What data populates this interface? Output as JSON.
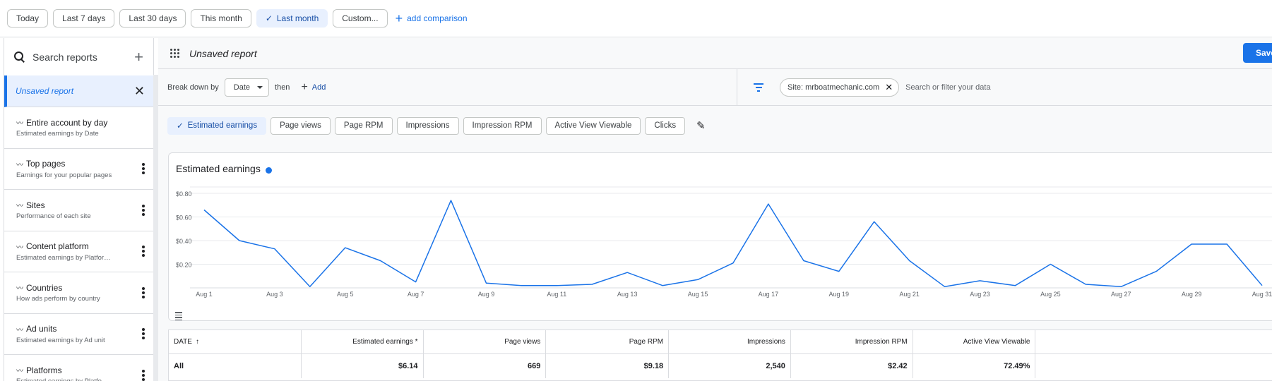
{
  "date_filters": {
    "chips": [
      "Today",
      "Last 7 days",
      "Last 30 days",
      "This month",
      "Last month",
      "Custom..."
    ],
    "selected": "Last month",
    "add_comparison": "add comparison"
  },
  "sidebar": {
    "search_placeholder": "Search reports",
    "active_report": "Unsaved report",
    "reports": [
      {
        "title": "Entire account by day",
        "subtitle": "Estimated earnings by Date",
        "has_menu": false
      },
      {
        "title": "Top pages",
        "subtitle": "Earnings for your popular pages",
        "has_menu": true
      },
      {
        "title": "Sites",
        "subtitle": "Performance of each site",
        "has_menu": true
      },
      {
        "title": "Content platform",
        "subtitle": "Estimated earnings by Platfor…",
        "has_menu": true
      },
      {
        "title": "Countries",
        "subtitle": "How ads perform by country",
        "has_menu": true
      },
      {
        "title": "Ad units",
        "subtitle": "Estimated earnings by Ad unit",
        "has_menu": true
      },
      {
        "title": "Platforms",
        "subtitle": "Estimated earnings by Platfo…",
        "has_menu": true
      }
    ]
  },
  "report": {
    "title": "Unsaved report",
    "save_label": "Save"
  },
  "breakdown": {
    "label": "Break down by",
    "dimension": "Date",
    "then": "then",
    "add": "Add",
    "filter_chip": "Site: mrboatmechanic.com",
    "filter_placeholder": "Search or filter your data"
  },
  "metrics": [
    "Estimated earnings",
    "Page views",
    "Page RPM",
    "Impressions",
    "Impression RPM",
    "Active View Viewable",
    "Clicks"
  ],
  "selected_metric": "Estimated earnings",
  "chart_data": {
    "type": "line",
    "title": "Estimated earnings",
    "series_color": "#1a73e8",
    "y_ticks": [
      "$0.20",
      "$0.40",
      "$0.60",
      "$0.80"
    ],
    "ylim": [
      0,
      0.8
    ],
    "x_tick_labels": [
      "Aug 1",
      "Aug 3",
      "Aug 5",
      "Aug 7",
      "Aug 9",
      "Aug 11",
      "Aug 13",
      "Aug 15",
      "Aug 17",
      "Aug 19",
      "Aug 21",
      "Aug 23",
      "Aug 25",
      "Aug 27",
      "Aug 29",
      "Aug 31"
    ],
    "x": [
      "Aug 1",
      "Aug 2",
      "Aug 3",
      "Aug 4",
      "Aug 5",
      "Aug 6",
      "Aug 7",
      "Aug 8",
      "Aug 9",
      "Aug 10",
      "Aug 11",
      "Aug 12",
      "Aug 13",
      "Aug 14",
      "Aug 15",
      "Aug 16",
      "Aug 17",
      "Aug 18",
      "Aug 19",
      "Aug 20",
      "Aug 21",
      "Aug 22",
      "Aug 23",
      "Aug 24",
      "Aug 25",
      "Aug 26",
      "Aug 27",
      "Aug 28",
      "Aug 29",
      "Aug 30",
      "Aug 31"
    ],
    "values": [
      0.66,
      0.4,
      0.33,
      0.01,
      0.34,
      0.23,
      0.05,
      0.74,
      0.04,
      0.02,
      0.02,
      0.03,
      0.13,
      0.02,
      0.07,
      0.21,
      0.71,
      0.23,
      0.14,
      0.56,
      0.23,
      0.01,
      0.06,
      0.02,
      0.2,
      0.03,
      0.01,
      0.14,
      0.37,
      0.37,
      0.02
    ]
  },
  "table": {
    "headers": [
      "DATE",
      "Estimated earnings *",
      "Page views",
      "Page RPM",
      "Impressions",
      "Impression RPM",
      "Active View Viewable",
      ""
    ],
    "total_row": [
      "All",
      "$6.14",
      "669",
      "$9.18",
      "2,540",
      "$2.42",
      "72.49%",
      ""
    ]
  }
}
